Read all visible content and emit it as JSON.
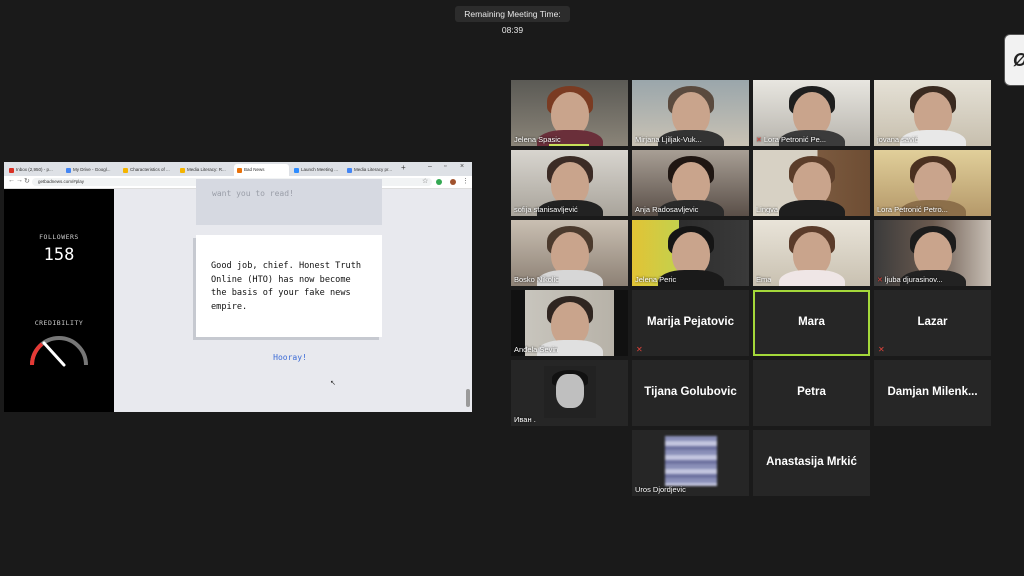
{
  "meeting": {
    "remaining_time": "Remaining Meeting Time: 08:39"
  },
  "browser": {
    "tabs": [
      {
        "label": "Inbox (2,950) - p...",
        "icon_color": "#d93025"
      },
      {
        "label": "My Drive - Googl...",
        "icon_color": "#4285f4"
      },
      {
        "label": "Characteristics of ...",
        "icon_color": "#f4b400"
      },
      {
        "label": "Media Literacy: R...",
        "icon_color": "#f4b400"
      },
      {
        "label": "Bad News",
        "icon_color": "#e8710a"
      },
      {
        "label": "Launch Meeting ...",
        "icon_color": "#2d8cff"
      },
      {
        "label": "Media Literacy pr...",
        "icon_color": "#4285f4"
      }
    ],
    "url": "getbadnews.com/#play"
  },
  "game": {
    "followers_label": "FOLLOWERS",
    "followers_value": "158",
    "credibility_label": "CREDIBILITY",
    "credibility_level": 0.35,
    "previous_message": "want you to read!",
    "message": "Good job, chief. Honest Truth Online (HTO) has now become the basis of your fake news empire.",
    "reply_option": "Hooray!"
  },
  "participants": [
    {
      "name": "Jelena Spasic",
      "video": true,
      "muted": false
    },
    {
      "name": "Mirjana Ljiljak-Vuk...",
      "video": true,
      "muted": false
    },
    {
      "name": "Lora Petronić Pe...",
      "video": true,
      "muted": true
    },
    {
      "name": "jovana savić",
      "video": true,
      "muted": false
    },
    {
      "name": "sofija stanisavljević",
      "video": true,
      "muted": false
    },
    {
      "name": "Anja Radosavljevic",
      "video": true,
      "muted": false
    },
    {
      "name": "Lingva",
      "video": true,
      "muted": false
    },
    {
      "name": "Lora Petronić Petro...",
      "video": true,
      "muted": false
    },
    {
      "name": "Bosko Nikolic",
      "video": true,
      "muted": false
    },
    {
      "name": "Jelena Peric",
      "video": true,
      "muted": false
    },
    {
      "name": "Ema",
      "video": true,
      "muted": false
    },
    {
      "name": "ljuba djurasinov...",
      "video": true,
      "muted": true
    },
    {
      "name": "Anđela Ševin",
      "video": true,
      "muted": false
    },
    {
      "name": "Marija Pejatovic",
      "video": false,
      "muted": true
    },
    {
      "name": "Mara",
      "video": false,
      "muted": false,
      "active_speaker": true
    },
    {
      "name": "Lazar",
      "video": false,
      "muted": true
    },
    {
      "name": "Иван .",
      "video": false,
      "avatar": true,
      "muted": false
    },
    {
      "name": "Tijana Golubovic",
      "video": false,
      "muted": false
    },
    {
      "name": "Petra",
      "video": false,
      "muted": false
    },
    {
      "name": "Damjan  Milenk...",
      "video": false,
      "muted": false
    },
    {
      "name": "Uros Djordjevic",
      "video": false,
      "blurred": true,
      "muted": false
    },
    {
      "name": "Anastasija Mrkić",
      "video": false,
      "muted": false
    }
  ]
}
